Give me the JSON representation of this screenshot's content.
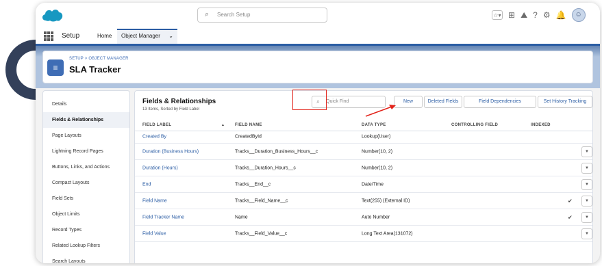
{
  "topbar": {
    "search_placeholder": "Search Setup",
    "icons": [
      "favorites-icon",
      "add-icon",
      "trailhead-icon",
      "help-icon",
      "gear-icon",
      "notification-bell-icon",
      "avatar"
    ]
  },
  "nav": {
    "app_name": "Setup",
    "tabs": [
      {
        "label": "Home"
      },
      {
        "label": "Object Manager"
      }
    ]
  },
  "header": {
    "breadcrumb": "SETUP > OBJECT MANAGER",
    "title": "SLA Tracker"
  },
  "sidebar": {
    "items": [
      {
        "label": "Details"
      },
      {
        "label": "Fields & Relationships"
      },
      {
        "label": "Page Layouts"
      },
      {
        "label": "Lightning Record Pages"
      },
      {
        "label": "Buttons, Links, and Actions"
      },
      {
        "label": "Compact Layouts"
      },
      {
        "label": "Field Sets"
      },
      {
        "label": "Object Limits"
      },
      {
        "label": "Record Types"
      },
      {
        "label": "Related Lookup Filters"
      },
      {
        "label": "Search Layouts"
      }
    ],
    "active_index": 1
  },
  "main": {
    "title": "Fields & Relationships",
    "subtitle": "13 Items, Sorted by Field Label",
    "quick_find_placeholder": "Quick Find",
    "buttons": {
      "new": "New",
      "deleted_fields": "Deleted Fields",
      "field_dependencies": "Field Dependencies",
      "history_tracking": "Set History Tracking"
    },
    "columns": {
      "field_label": "FIELD LABEL",
      "field_name": "FIELD NAME",
      "data_type": "DATA TYPE",
      "controlling_field": "CONTROLLING FIELD",
      "indexed": "INDEXED"
    },
    "sort_indicator": "▲",
    "rows": [
      {
        "label": "Created By",
        "name": "CreatedById",
        "type": "Lookup(User)",
        "indexed": "",
        "menu": ""
      },
      {
        "label": "Duration (Business Hours)",
        "name": "Tracks__Duration_Business_Hours__c",
        "type": "Number(10, 2)",
        "indexed": "",
        "menu": "▼"
      },
      {
        "label": "Duration (Hours)",
        "name": "Tracks__Duration_Hours__c",
        "type": "Number(10, 2)",
        "indexed": "",
        "menu": "▼"
      },
      {
        "label": "End",
        "name": "Tracks__End__c",
        "type": "Date/Time",
        "indexed": "",
        "menu": "▼"
      },
      {
        "label": "Field Name",
        "name": "Tracks__Field_Name__c",
        "type": "Text(255) (External ID)",
        "indexed": "✔",
        "menu": "▼"
      },
      {
        "label": "Field Tracker Name",
        "name": "Name",
        "type": "Auto Number",
        "indexed": "✔",
        "menu": "▼"
      },
      {
        "label": "Field Value",
        "name": "Tracks__Field_Value__c",
        "type": "Long Text Area(131072)",
        "indexed": "",
        "menu": "▼"
      }
    ]
  },
  "colors": {
    "brand_blue": "#2b5da4",
    "highlight_red": "#e2231a",
    "header_band": "#b0c4df"
  }
}
